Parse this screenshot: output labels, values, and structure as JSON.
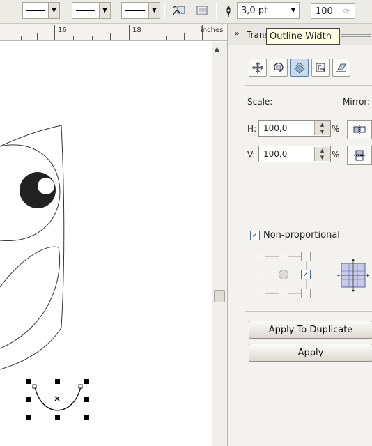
{
  "toolbar": {
    "outline_width_value": "3,0 pt",
    "text_size_value": "100"
  },
  "ruler": {
    "labels": [
      "16",
      "18",
      "inches"
    ]
  },
  "docker": {
    "title": "Trans",
    "tooltip": "Outline Width",
    "scale_label": "Scale:",
    "mirror_label": "Mirror:",
    "h_label": "H:",
    "h_value": "100,0",
    "v_label": "V:",
    "v_value": "100,0",
    "percent": "%",
    "non_proportional_label": "Non-proportional",
    "non_proportional_checked": true,
    "apply_to_duplicate": "Apply To Duplicate",
    "apply": "Apply"
  },
  "colors": {
    "toolbar_bg": "#ecebe6",
    "panel_bg": "#f3f2ef",
    "tooltip_bg": "#ffffe1",
    "active_mode": "#c8dcef"
  }
}
